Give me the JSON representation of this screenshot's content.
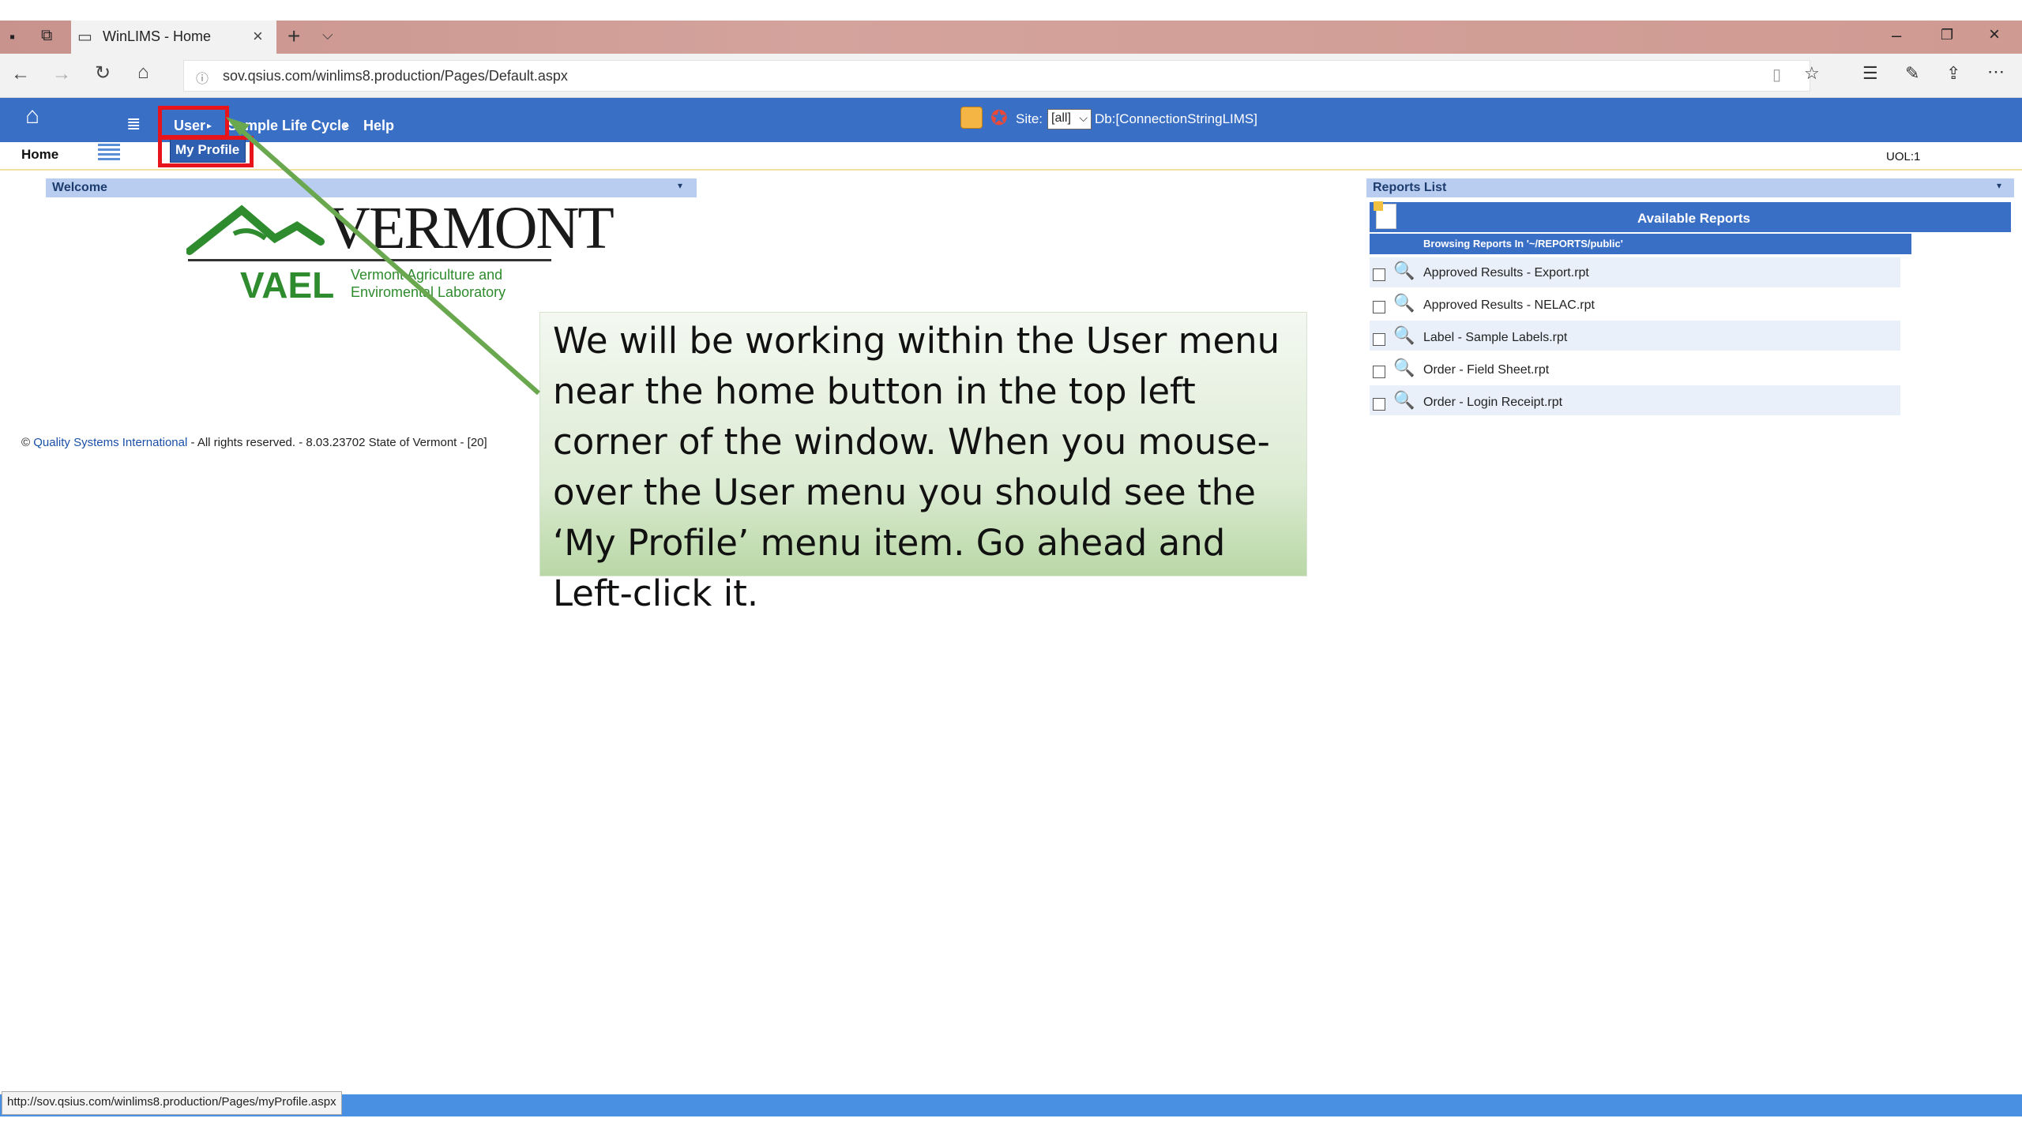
{
  "browser": {
    "tab_title": "WinLIMS - Home",
    "url": "sov.qsius.com/winlims8.production/Pages/Default.aspx"
  },
  "app": {
    "menu": {
      "user": "User",
      "sample_life_cycle": "Sample Life Cycle",
      "help": "Help",
      "my_profile": "My Profile"
    },
    "site_label": "Site:",
    "site_value": "[all]",
    "db_label": "Db:[ConnectionStringLIMS]",
    "home_label": "Home",
    "uol": "UOL:1"
  },
  "welcome": {
    "title": "Welcome",
    "logo_main": "VERMONT",
    "logo_abbr": "VAEL",
    "logo_line1": "Vermont Agriculture and",
    "logo_line2": "Enviromental Laboratory",
    "footer_link": "Quality Systems International",
    "footer_prefix": "©",
    "footer_rest": " - All rights reserved. - 8.03.23702 State of Vermont - [20]"
  },
  "reports": {
    "title": "Reports List",
    "available": "Available Reports",
    "browsing": "Browsing Reports In '~/REPORTS/public'",
    "items": [
      "Approved Results - Export.rpt",
      "Approved Results - NELAC.rpt",
      "Label - Sample Labels.rpt",
      "Order - Field Sheet.rpt",
      "Order - Login Receipt.rpt"
    ]
  },
  "callout": {
    "text": "We will be working within the User menu near the home button in the top left corner of the window.  When you mouse-over the User menu you should see the ‘My Profile’ menu item.  Go ahead and Left-click it."
  },
  "status": {
    "link_url": "http://sov.qsius.com/winlims8.production/Pages/myProfile.aspx"
  },
  "colors": {
    "app_header": "#3a6fc6",
    "highlight": "#e8141b",
    "arrow": "#6aa84f"
  }
}
